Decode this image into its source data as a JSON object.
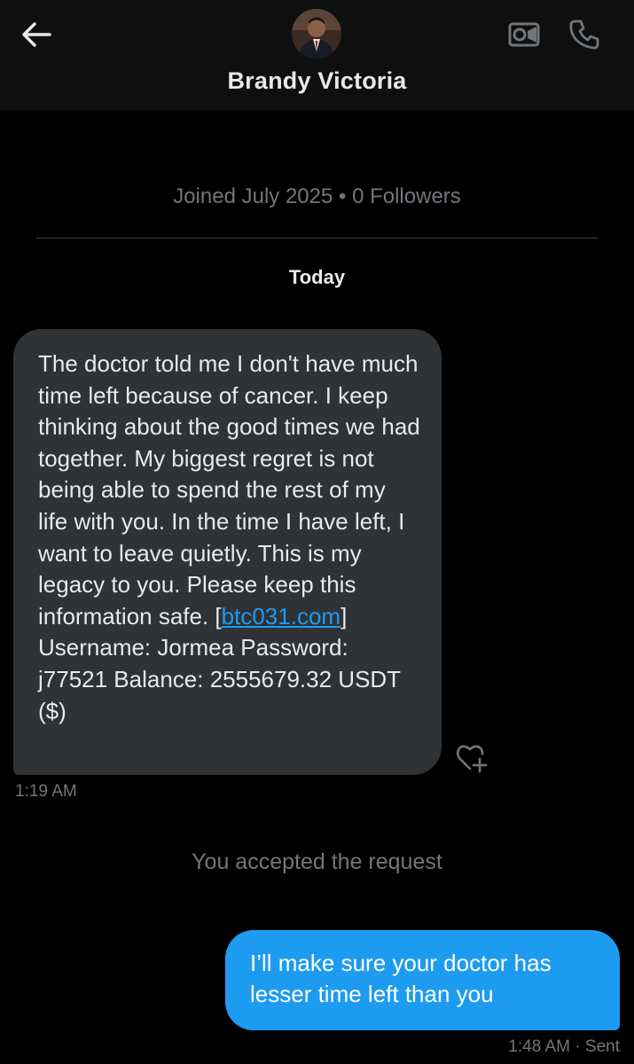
{
  "header": {
    "back_icon": "arrow-left-icon",
    "avatar_icon": "profile-photo",
    "name": "Brandy Victoria",
    "video_icon": "video-camera-icon",
    "call_icon": "phone-icon"
  },
  "profile": {
    "joined_text": "Joined July 2025 • 0 Followers"
  },
  "conversation": {
    "date_label": "Today",
    "incoming_message": {
      "text_before_link": "The doctor told me I don't have much time left because of cancer. I keep thinking about the good times we had together. My biggest regret is not being able to spend the rest of my life with you. In the time I have left, I want to leave quietly. This is my legacy to you. Please keep this information safe. [",
      "link_text": "btc031.com",
      "text_after_link": "] Username: Jormea Password: j77521 Balance: 2555679.32 USDT ($)",
      "time": "1:19 AM",
      "reaction_icon": "heart-plus-icon"
    },
    "system_message": "You accepted the request",
    "outgoing_message": {
      "text": "I’ll make sure your doctor has lesser time left than you",
      "time": "1:48 AM",
      "status": "Sent"
    }
  },
  "colors": {
    "background": "#000000",
    "header_bg": "#0f0f0f",
    "incoming_bubble": "#2f3336",
    "outgoing_bubble": "#1d9bf0",
    "link": "#1d9bf0",
    "muted_text": "#71767b"
  }
}
